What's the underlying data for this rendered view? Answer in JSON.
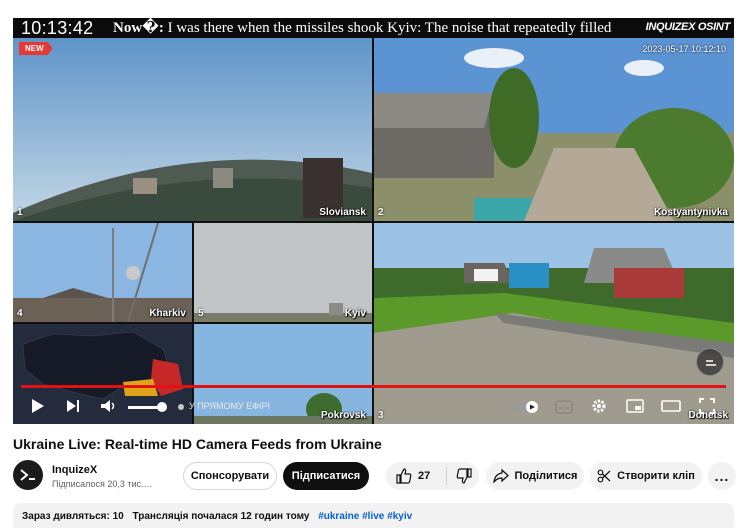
{
  "player": {
    "clock": "10:13:42",
    "ticker_prefix": "Now�:",
    "ticker_text": " I was there when the missiles shook Kyiv: The noise that repeatedly filled",
    "brand": "INQUIZEX OSINT",
    "new_badge": "NEW",
    "cam2_timestamp": "2023-05-17 10:12:10",
    "live_label": "У ПРЯМОМУ ЕФІРІ",
    "cameras": [
      {
        "num": "1",
        "label": "Sloviansk"
      },
      {
        "num": "2",
        "label": "Kostyantynivka"
      },
      {
        "num": "4",
        "label": "Kharkiv"
      },
      {
        "num": "5",
        "label": "Kyiv"
      },
      {
        "num": "3",
        "label": "Donetsk"
      },
      {
        "num": "",
        "label": "Pokrovsk"
      }
    ],
    "progress_fraction": 1.0,
    "volume_fraction": 0.9
  },
  "video": {
    "title": "Ukraine Live: Real-time HD Camera Feeds from Ukraine"
  },
  "channel": {
    "name": "InquizeX",
    "subscribers": "Підписалося 20,3 тис.…"
  },
  "actions": {
    "sponsor": "Спонсорувати",
    "subscribe": "Підписатися",
    "likes": "27",
    "share": "Поділитися",
    "clip": "Створити кліп",
    "more": "..."
  },
  "description": {
    "watching": "Зараз дивляться: 10",
    "started": "Трансляція почалася 12 годин тому",
    "tags": [
      "#ukraine",
      "#live",
      "#kyiv"
    ]
  },
  "icons": [
    "play-icon",
    "next-icon",
    "volume-icon",
    "autoplay-toggle-icon",
    "subtitles-icon",
    "settings-icon",
    "miniplayer-icon",
    "theater-icon",
    "fullscreen-icon",
    "like-icon",
    "dislike-icon",
    "share-icon",
    "scissors-icon"
  ]
}
